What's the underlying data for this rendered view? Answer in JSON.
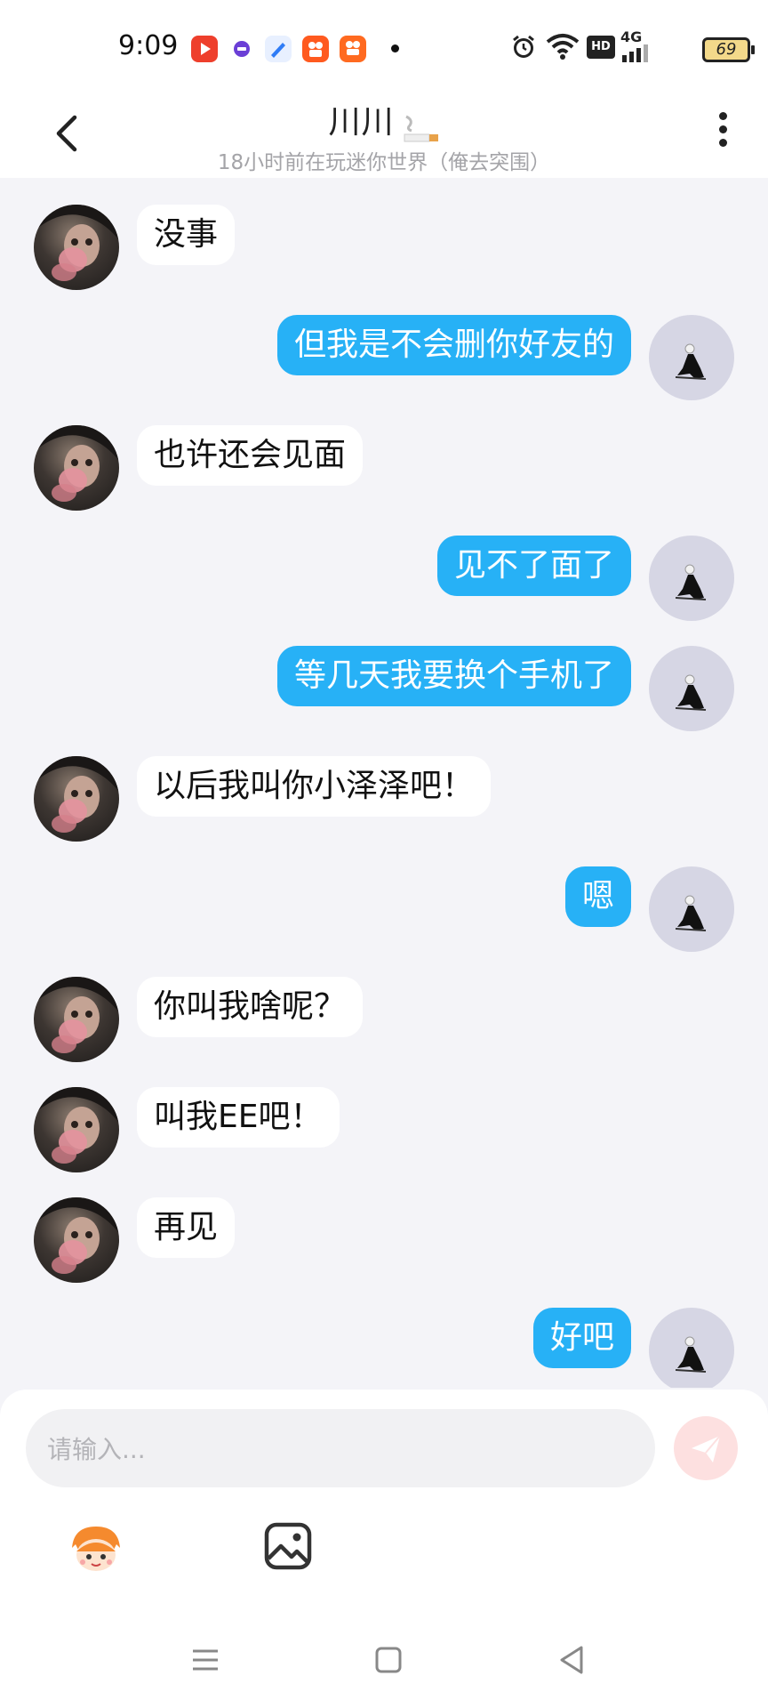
{
  "status_bar": {
    "time": "9:09",
    "network": "4G",
    "hd_label": "HD",
    "battery": "69"
  },
  "header": {
    "title": "川川",
    "subtitle": "18小时前在玩迷你世界（俺去突围）"
  },
  "messages": [
    {
      "side": "in",
      "text": "没事"
    },
    {
      "side": "out",
      "text": "但我是不会删你好友的"
    },
    {
      "side": "in",
      "text": "也许还会见面"
    },
    {
      "side": "out",
      "text": "见不了面了"
    },
    {
      "side": "out",
      "text": "等几天我要换个手机了"
    },
    {
      "side": "in",
      "text": "以后我叫你小泽泽吧！"
    },
    {
      "side": "out",
      "text": "嗯"
    },
    {
      "side": "in",
      "text": "你叫我啥呢？"
    },
    {
      "side": "in",
      "text": "叫我EE吧！"
    },
    {
      "side": "in",
      "text": "再见"
    },
    {
      "side": "out",
      "text": "好吧"
    }
  ],
  "composer": {
    "placeholder": "请输入..."
  },
  "colors": {
    "outgoing_bubble": "#27b1f6",
    "incoming_bubble": "#ffffff",
    "background": "#f4f4f8"
  }
}
